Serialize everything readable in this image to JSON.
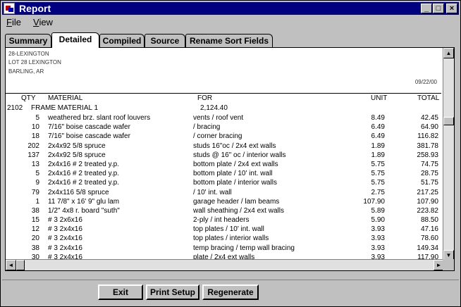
{
  "window": {
    "title": "Report",
    "minimize": "_",
    "maximize": "□",
    "close": "×"
  },
  "menu": [
    {
      "label": "File",
      "hot": "F",
      "rest": "ile"
    },
    {
      "label": "View",
      "hot": "V",
      "rest": "iew"
    }
  ],
  "tabs": [
    "Summary",
    "Detailed",
    "Compiled",
    "Source",
    "Rename Sort Fields"
  ],
  "active_tab": "Detailed",
  "report": {
    "header_lines": [
      "28-LEXINGTON",
      "LOT 28 LEXINGTON",
      "BARLING, AR"
    ],
    "date": "09/22/00",
    "columns": {
      "qty": "QTY",
      "material": "MATERIAL",
      "for": "FOR",
      "unit": "UNIT",
      "total": "TOTAL"
    },
    "section": {
      "code": "2102",
      "name": "FRAME MATERIAL 1",
      "amount": "2,124.40"
    },
    "rows": [
      {
        "qty": "5",
        "material": "weathered brz. slant roof louvers",
        "for": "vents  /  roof vent",
        "unit": "8.49",
        "total": "42.45"
      },
      {
        "qty": "10",
        "material": "7/16\" boise cascade wafer",
        "for": " /  bracing",
        "unit": "6.49",
        "total": "64.90"
      },
      {
        "qty": "18",
        "material": "7/16\" boise cascade wafer",
        "for": " /  corner bracing",
        "unit": "6.49",
        "total": "116.82"
      },
      {
        "qty": "202",
        "material": "2x4x92 5/8 spruce",
        "for": "studs 16\"oc  /  2x4 ext walls",
        "unit": "1.89",
        "total": "381.78"
      },
      {
        "qty": "137",
        "material": "2x4x92 5/8 spruce",
        "for": "studs @ 16\" oc  /  interior walls",
        "unit": "1.89",
        "total": "258.93"
      },
      {
        "qty": "13",
        "material": "2x4x16 # 2 treated y.p.",
        "for": "bottom plate  /  2x4 ext walls",
        "unit": "5.75",
        "total": "74.75"
      },
      {
        "qty": "5",
        "material": "2x4x16 # 2 treated y.p.",
        "for": "bottom plate  /  10' int. wall",
        "unit": "5.75",
        "total": "28.75"
      },
      {
        "qty": "9",
        "material": "2x4x16 # 2 treated y.p.",
        "for": "bottom plate  /  interior walls",
        "unit": "5.75",
        "total": "51.75"
      },
      {
        "qty": "79",
        "material": "2x4x116 5/8 spruce",
        "for": " /  10' int. wall",
        "unit": "2.75",
        "total": "217.25"
      },
      {
        "qty": "1",
        "material": "11 7/8\" x 16' 9\" glu lam",
        "for": "garage header  /  lam beams",
        "unit": "107.90",
        "total": "107.90"
      },
      {
        "qty": "38",
        "material": "1/2\" 4x8 r. board \"suth\"",
        "for": "wall sheathing  /  2x4 ext walls",
        "unit": "5.89",
        "total": "223.82"
      },
      {
        "qty": "15",
        "material": "# 3 2x6x16",
        "for": "2-ply  /  int headers",
        "unit": "5.90",
        "total": "88.50"
      },
      {
        "qty": "12",
        "material": "# 3 2x4x16",
        "for": "top plates  /  10' int. wall",
        "unit": "3.93",
        "total": "47.16"
      },
      {
        "qty": "20",
        "material": "# 3 2x4x16",
        "for": "top plates  /  interior walls",
        "unit": "3.93",
        "total": "78.60"
      },
      {
        "qty": "38",
        "material": "# 3 2x4x16",
        "for": "temp bracing  /  temp wall bracing",
        "unit": "3.93",
        "total": "149.34"
      },
      {
        "qty": "30",
        "material": "# 3 2x4x16",
        "for": "plate  /  2x4 ext walls",
        "unit": "3.93",
        "total": "117.90"
      }
    ]
  },
  "buttons": {
    "exit": "Exit",
    "print_setup": "Print Setup",
    "regenerate": "Regenerate"
  },
  "icons": {
    "scroll_up": "▲",
    "scroll_down": "▼",
    "scroll_left": "◄",
    "scroll_right": "►"
  }
}
